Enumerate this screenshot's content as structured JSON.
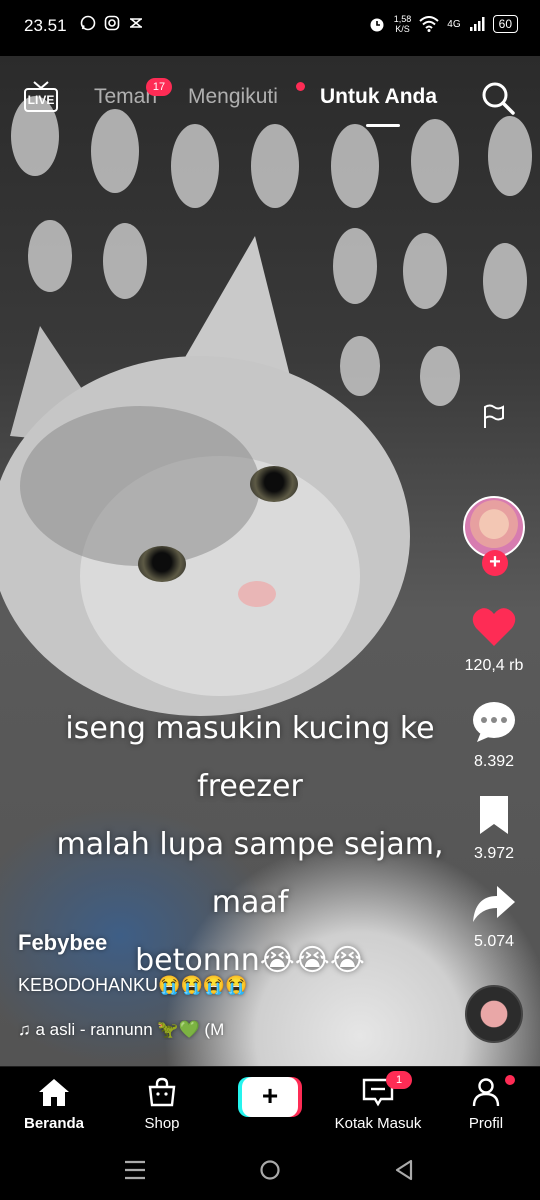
{
  "status_bar": {
    "time": "23.51",
    "net_speed_value": "1,58",
    "net_speed_unit": "K/S",
    "network": "4G",
    "battery": "60"
  },
  "top_nav": {
    "live_label": "LIVE",
    "tabs": [
      {
        "label": "Teman",
        "badge": "17"
      },
      {
        "label": "Mengikuti"
      },
      {
        "label": "Untuk Anda"
      }
    ]
  },
  "video": {
    "overlay_lines": [
      "iseng masukin kucing ke freezer",
      "malah lupa sampe sejam, maaf",
      "betonnn😭😭😭"
    ],
    "author": "Febybee",
    "description": "KEBODOHANKU😭😭😭😭",
    "music": "♫ a asli - rannunn 🦖💚 (M"
  },
  "actions": {
    "likes": "120,4 rb",
    "comments": "8.392",
    "saves": "3.972",
    "shares": "5.074"
  },
  "bottom_nav": {
    "items": [
      {
        "label": "Beranda"
      },
      {
        "label": "Shop"
      },
      {
        "label": "Kotak Masuk",
        "badge": "1"
      },
      {
        "label": "Profil"
      }
    ]
  },
  "colors": {
    "accent": "#fe2c55",
    "accent2": "#25f4ee"
  }
}
